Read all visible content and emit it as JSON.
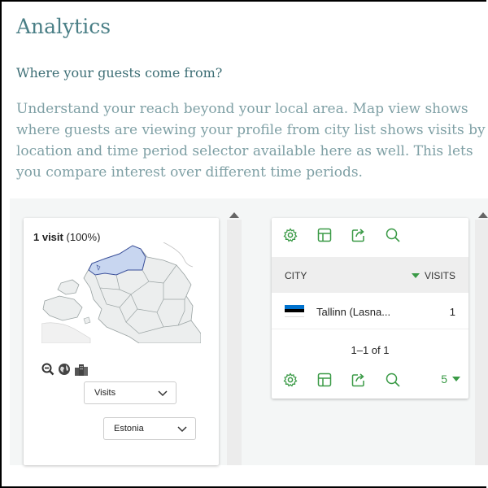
{
  "header": {
    "title": "Analytics",
    "subtitle": "Where your guests come from?",
    "description": "Understand your reach beyond your local area. Map view shows where guests are viewing your profile from city list shows visits by location and time period selector available here as well. This lets you compare interest over different time periods."
  },
  "map_card": {
    "visit_count": "1 visit",
    "visit_percent": "(100%)",
    "metric_select": "Visits",
    "region_select": "Estonia",
    "controls": [
      "zoom-out-icon",
      "globe-icon",
      "city-icon"
    ]
  },
  "table_card": {
    "toolbar": [
      "settings-icon",
      "columns-icon",
      "export-icon",
      "search-icon"
    ],
    "columns": [
      "CITY",
      "VISITS"
    ],
    "rows": [
      {
        "city": "Tallinn (Lasna...",
        "visits": "1"
      }
    ],
    "pagination": "1–1 of 1",
    "per_page": "5"
  },
  "colors": {
    "accent": "#4a7f86",
    "green": "#3a9a46",
    "map_highlight": "#c8d6f0",
    "map_fill": "#eceeee"
  }
}
